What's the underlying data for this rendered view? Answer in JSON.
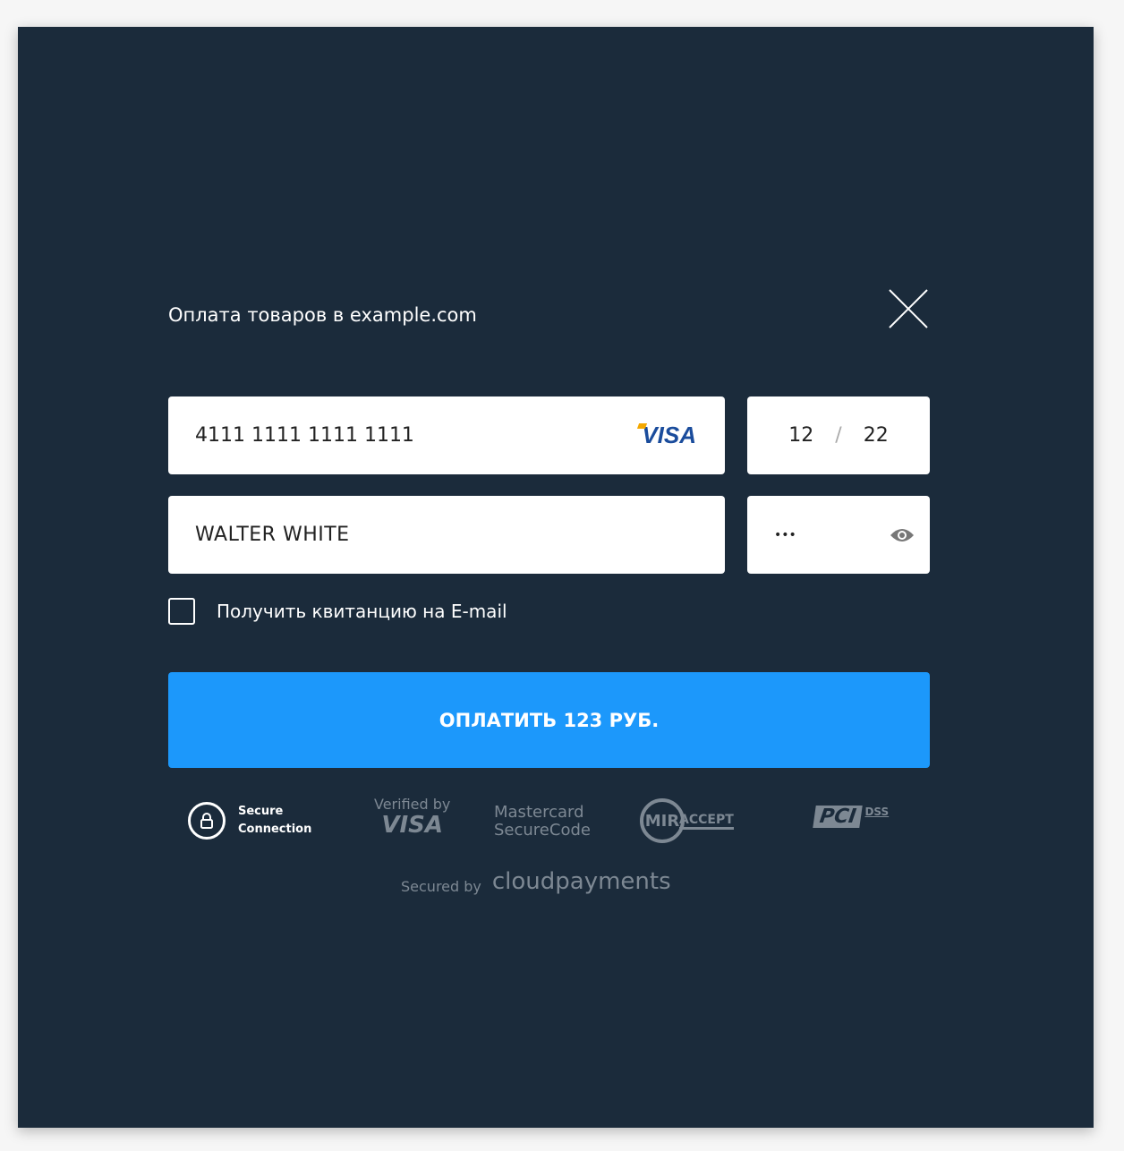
{
  "dialog": {
    "title": "Оплата товаров в example.com",
    "close_icon": "close-icon"
  },
  "form": {
    "card_number": "4111 1111 1111 1111",
    "card_brand": "VISA",
    "exp_month": "12",
    "exp_separator": "/",
    "exp_year": "22",
    "cardholder": "WALTER WHITE",
    "cvv": "•••",
    "cvv_icon": "eye-icon",
    "email_receipt_label": "Получить квитанцию на E-mail",
    "email_receipt_checked": false,
    "pay_button": "ОПЛАТИТЬ 123 РУБ."
  },
  "badges": {
    "secure_1": "Secure",
    "secure_2": "Connection",
    "verified_by": "Verified by",
    "verified_visa": "VISA",
    "mastercard_1": "Mastercard",
    "mastercard_2": "SecureCode",
    "mir": "MIR",
    "mir_accept": "ACCEPT",
    "pci": "PCI",
    "dss": "DSS",
    "secured_by": "Secured by",
    "provider": "cloudpayments"
  },
  "colors": {
    "background": "#1b2b3b",
    "accent": "#1c98fb"
  }
}
